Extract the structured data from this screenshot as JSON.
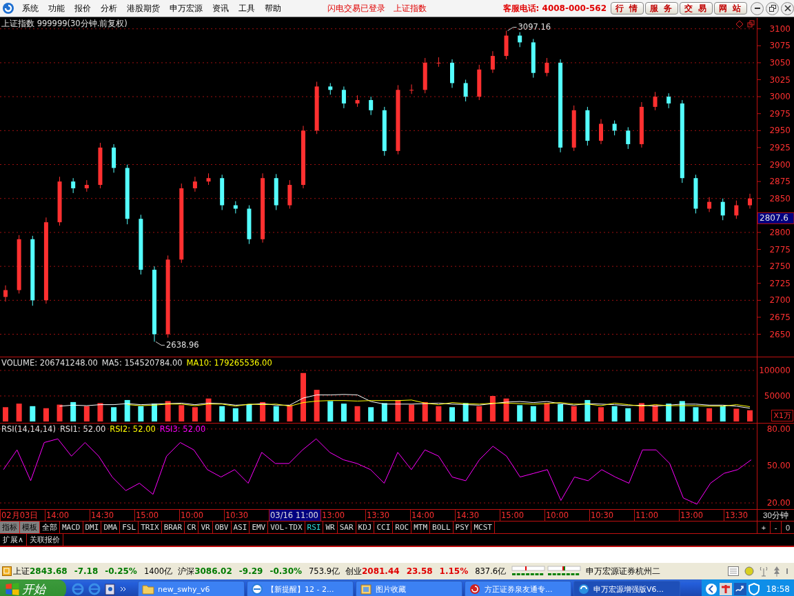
{
  "menu": [
    {
      "label": "系统"
    },
    {
      "label": "功能"
    },
    {
      "label": "报价"
    },
    {
      "label": "分析"
    },
    {
      "label": "港股期货"
    },
    {
      "label": "申万宏源"
    },
    {
      "label": "资讯"
    },
    {
      "label": "工具"
    },
    {
      "label": "帮助"
    }
  ],
  "notices": [
    "闪电交易已登录",
    "上证指数"
  ],
  "hotline": "客服电话: 4008-000-562",
  "top_buttons": [
    "行情",
    "服务",
    "交易",
    "网站"
  ],
  "price_panel": {
    "title": "上证指数 999999(30分钟.前复权)",
    "last_price": "2807.6",
    "high_label": "3097.16",
    "low_label": "2638.96",
    "chart_data": {
      "type": "candlestick",
      "grid": true,
      "ylim": [
        2617,
        3116
      ],
      "yticks": [
        2650,
        2675,
        2700,
        2725,
        2750,
        2775,
        2800,
        2850,
        2875,
        2900,
        2925,
        2950,
        2975,
        3000,
        3025,
        3050,
        3075,
        3100
      ],
      "ohlc": [
        [
          2705,
          2722,
          2698,
          2715
        ],
        [
          2715,
          2796,
          2710,
          2790
        ],
        [
          2790,
          2795,
          2692,
          2700
        ],
        [
          2700,
          2822,
          2695,
          2815
        ],
        [
          2815,
          2882,
          2810,
          2875
        ],
        [
          2875,
          2880,
          2858,
          2865
        ],
        [
          2865,
          2877,
          2860,
          2870
        ],
        [
          2870,
          2932,
          2865,
          2925
        ],
        [
          2925,
          2930,
          2888,
          2895
        ],
        [
          2895,
          2900,
          2812,
          2820
        ],
        [
          2820,
          2826,
          2738,
          2745
        ],
        [
          2745,
          2750,
          2638.96,
          2650
        ],
        [
          2650,
          2766,
          2645,
          2760
        ],
        [
          2760,
          2872,
          2755,
          2865
        ],
        [
          2865,
          2882,
          2860,
          2875
        ],
        [
          2875,
          2887,
          2870,
          2880
        ],
        [
          2880,
          2885,
          2833,
          2840
        ],
        [
          2840,
          2846,
          2828,
          2835
        ],
        [
          2835,
          2840,
          2783,
          2790
        ],
        [
          2790,
          2887,
          2785,
          2880
        ],
        [
          2880,
          2886,
          2833,
          2840
        ],
        [
          2840,
          2877,
          2835,
          2870
        ],
        [
          2870,
          2957,
          2865,
          2950
        ],
        [
          2950,
          3022,
          2945,
          3015
        ],
        [
          3015,
          3020,
          3003,
          3010
        ],
        [
          3010,
          3015,
          2983,
          2990
        ],
        [
          2990,
          3002,
          2985,
          2995
        ],
        [
          2995,
          3000,
          2973,
          2980
        ],
        [
          2980,
          2985,
          2913,
          2920
        ],
        [
          2920,
          3017,
          2915,
          3010
        ],
        [
          3010,
          3018,
          3004,
          3010
        ],
        [
          3010,
          3057,
          3005,
          3050
        ],
        [
          3050,
          3058,
          3044,
          3050
        ],
        [
          3050,
          3055,
          3013,
          3020
        ],
        [
          3020,
          3025,
          2993,
          3000
        ],
        [
          3000,
          3047,
          2995,
          3040
        ],
        [
          3040,
          3067,
          3035,
          3060
        ],
        [
          3060,
          3097.16,
          3055,
          3090
        ],
        [
          3090,
          3095,
          3073,
          3080
        ],
        [
          3080,
          3085,
          3028,
          3035
        ],
        [
          3035,
          3057,
          3030,
          3050
        ],
        [
          3050,
          3055,
          2918,
          2925
        ],
        [
          2925,
          2987,
          2920,
          2980
        ],
        [
          2980,
          2985,
          2928,
          2935
        ],
        [
          2935,
          2967,
          2930,
          2960
        ],
        [
          2960,
          2965,
          2943,
          2950
        ],
        [
          2950,
          2955,
          2923,
          2930
        ],
        [
          2930,
          2992,
          2925,
          2985
        ],
        [
          2985,
          3007,
          2980,
          3000
        ],
        [
          3000,
          3005,
          2983,
          2990
        ],
        [
          2990,
          2995,
          2873,
          2880
        ],
        [
          2880,
          2885,
          2828,
          2835
        ],
        [
          2835,
          2852,
          2830,
          2845
        ],
        [
          2845,
          2850,
          2818,
          2825
        ],
        [
          2825,
          2847,
          2820,
          2840
        ],
        [
          2840,
          2857,
          2835,
          2850
        ]
      ]
    }
  },
  "volume_panel": {
    "readings": [
      {
        "text": "VOLUME: 206741248.00",
        "color": "#e0e0e0"
      },
      {
        "text": "MA5: 154520784.00",
        "color": "#e0e0e0"
      },
      {
        "text": "MA10: 179265536.00",
        "color": "#ffff00"
      }
    ],
    "unit": "X1万",
    "chart_data": {
      "type": "bar",
      "grid": true,
      "ylim": [
        0,
        125700
      ],
      "yticks": [
        50000,
        100000
      ],
      "series": [
        {
          "color": "#ff3030",
          "values": [
            28000,
            35000,
            null,
            26000,
            33000,
            null,
            30000,
            36000,
            null,
            null,
            null,
            null,
            40000,
            32000,
            28000,
            45000,
            null,
            null,
            null,
            38000,
            null,
            32000,
            95000,
            62000,
            null,
            null,
            30000,
            null,
            null,
            42000,
            33000,
            38000,
            30000,
            null,
            null,
            30000,
            50000,
            45000,
            null,
            null,
            36000,
            null,
            30000,
            null,
            28000,
            null,
            null,
            36000,
            32000,
            null,
            null,
            null,
            26000,
            null,
            25000,
            22000
          ]
        },
        {
          "color": "#54ffff",
          "values": [
            null,
            null,
            30000,
            null,
            null,
            38000,
            null,
            null,
            28000,
            42000,
            30000,
            35000,
            null,
            null,
            null,
            null,
            30000,
            26000,
            34000,
            null,
            30000,
            null,
            null,
            null,
            40000,
            35000,
            null,
            28000,
            36000,
            null,
            null,
            null,
            null,
            28000,
            36000,
            null,
            null,
            null,
            32000,
            30000,
            null,
            34000,
            null,
            42000,
            null,
            30000,
            26000,
            null,
            null,
            35000,
            40000,
            28000,
            null,
            30000,
            null,
            null
          ]
        },
        {
          "type": "line",
          "color": "#ffffff",
          "values": [
            null,
            null,
            null,
            null,
            30000,
            32000,
            31000,
            33000,
            33000,
            35000,
            33000,
            34000,
            35000,
            36000,
            33000,
            36000,
            35000,
            32000,
            33000,
            35000,
            32000,
            32000,
            46000,
            52000,
            52000,
            53000,
            52000,
            39000,
            34000,
            34000,
            34000,
            35000,
            36000,
            34000,
            33000,
            32000,
            35000,
            38000,
            39000,
            37000,
            39000,
            35000,
            32000,
            35000,
            34000,
            33000,
            31000,
            32000,
            30000,
            32000,
            34000,
            34000,
            32000,
            32000,
            30000,
            26000
          ]
        },
        {
          "type": "line",
          "color": "#ffff00",
          "values": [
            null,
            null,
            null,
            null,
            null,
            null,
            null,
            null,
            null,
            33000,
            31000,
            32000,
            34000,
            34000,
            31000,
            34000,
            34000,
            30000,
            34000,
            33000,
            34000,
            30000,
            37000,
            40000,
            41000,
            41000,
            40000,
            41000,
            41000,
            41000,
            42000,
            36000,
            33000,
            37000,
            35000,
            34000,
            36000,
            36000,
            35000,
            34000,
            35000,
            37000,
            34000,
            34000,
            31000,
            36000,
            33000,
            30000,
            33000,
            31000,
            31000,
            31000,
            30000,
            30000,
            33000,
            29000
          ]
        }
      ]
    }
  },
  "rsi_panel": {
    "readings": [
      {
        "text": "RSI(14,14,14)",
        "color": "#e0e0e0"
      },
      {
        "text": "RSI1: 52.00",
        "color": "#e0e0e0"
      },
      {
        "text": "RSI2: 52.00",
        "color": "#ffff00"
      },
      {
        "text": "RSI3: 52.00",
        "color": "#ff00ff"
      }
    ],
    "chart_data": {
      "type": "line",
      "ylim": [
        15,
        84.4
      ],
      "grid": true,
      "yticks": [
        {
          "value": 20,
          "label": "20.00"
        },
        {
          "value": 50,
          "label": "50.00"
        },
        {
          "value": 80,
          "label": "80.00"
        }
      ],
      "values": [
        47,
        63,
        38,
        69,
        72,
        58,
        69,
        58,
        41,
        30,
        36,
        27,
        58,
        69,
        63,
        47,
        41,
        47,
        36,
        61,
        52,
        52,
        63,
        72,
        61,
        55,
        52,
        47,
        36,
        61,
        47,
        63,
        58,
        41,
        38,
        55,
        66,
        58,
        41,
        44,
        47,
        22,
        41,
        38,
        47,
        41,
        36,
        63,
        63,
        52,
        24,
        19,
        36,
        44,
        47,
        55
      ]
    }
  },
  "time_axis": [
    {
      "label": "02月03日",
      "selected": false
    },
    {
      "label": "14:00",
      "selected": false
    },
    {
      "label": "14:30",
      "selected": false
    },
    {
      "label": "15:00",
      "selected": false
    },
    {
      "label": "10:00",
      "selected": false
    },
    {
      "label": "10:30",
      "selected": false
    },
    {
      "label": "03/16 11:00",
      "selected": true
    },
    {
      "label": "13:00",
      "selected": false
    },
    {
      "label": "13:30",
      "selected": false
    },
    {
      "label": "14:00",
      "selected": false
    },
    {
      "label": "14:30",
      "selected": false
    },
    {
      "label": "15:00",
      "selected": false
    },
    {
      "label": "10:00",
      "selected": false
    },
    {
      "label": "10:30",
      "selected": false
    },
    {
      "label": "11:00",
      "selected": false
    },
    {
      "label": "13:00",
      "selected": false
    },
    {
      "label": "13:30",
      "selected": false
    }
  ],
  "period": "30分钟",
  "indicator_tabs": [
    {
      "label": "指标",
      "kind": "group",
      "selected": false
    },
    {
      "label": "模板",
      "kind": "group",
      "selected": false
    },
    {
      "label": "全部",
      "kind": "indicator",
      "selected": false
    },
    {
      "label": "MACD",
      "kind": "indicator",
      "selected": false
    },
    {
      "label": "DMI",
      "kind": "indicator",
      "selected": false
    },
    {
      "label": "DMA",
      "kind": "indicator",
      "selected": false
    },
    {
      "label": "FSL",
      "kind": "indicator",
      "selected": false
    },
    {
      "label": "TRIX",
      "kind": "indicator",
      "selected": false
    },
    {
      "label": "BRAR",
      "kind": "indicator",
      "selected": false
    },
    {
      "label": "CR",
      "kind": "indicator",
      "selected": false
    },
    {
      "label": "VR",
      "kind": "indicator",
      "selected": false
    },
    {
      "label": "OBV",
      "kind": "indicator",
      "selected": false
    },
    {
      "label": "ASI",
      "kind": "indicator",
      "selected": false
    },
    {
      "label": "EMV",
      "kind": "indicator",
      "selected": false
    },
    {
      "label": "VOL-TDX",
      "kind": "indicator",
      "selected": false
    },
    {
      "label": "RSI",
      "kind": "indicator",
      "selected": true
    },
    {
      "label": "WR",
      "kind": "indicator",
      "selected": false
    },
    {
      "label": "SAR",
      "kind": "indicator",
      "selected": false
    },
    {
      "label": "KDJ",
      "kind": "indicator",
      "selected": false
    },
    {
      "label": "CCI",
      "kind": "indicator",
      "selected": false
    },
    {
      "label": "ROC",
      "kind": "indicator",
      "selected": false
    },
    {
      "label": "MTM",
      "kind": "indicator",
      "selected": false
    },
    {
      "label": "BOLL",
      "kind": "indicator",
      "selected": false
    },
    {
      "label": "PSY",
      "kind": "indicator",
      "selected": false
    },
    {
      "label": "MCST",
      "kind": "indicator",
      "selected": false
    }
  ],
  "zoom_buttons": [
    "+",
    "-",
    "0"
  ],
  "extra_tabs": [
    "扩展∧",
    "关联报价"
  ],
  "indices": [
    {
      "name": "上证",
      "value": "2843.68",
      "change": "-7.18",
      "percent": "-0.25%",
      "amount": "1400亿",
      "color": "#007a00"
    },
    {
      "name": "沪深",
      "value": "3086.02",
      "change": "-9.29",
      "percent": "-0.30%",
      "amount": "753.9亿",
      "color": "#007a00"
    },
    {
      "name": "创业",
      "value": "2081.44",
      "change": "23.58",
      "percent": "1.15%",
      "amount": "837.6亿",
      "color": "#e00000"
    }
  ],
  "broker": "申万宏源证券杭州二",
  "taskbar": {
    "start": "开始",
    "tasks": [
      {
        "label": "new_swhy_v6",
        "selected": false
      },
      {
        "label": "【新提醒】12 - 2...",
        "selected": false
      },
      {
        "label": "图片收藏",
        "selected": false
      },
      {
        "label": "方正证券泉友通专...",
        "selected": false
      },
      {
        "label": "申万宏源增强版V6...",
        "selected": true
      }
    ],
    "clock": "18:58"
  }
}
